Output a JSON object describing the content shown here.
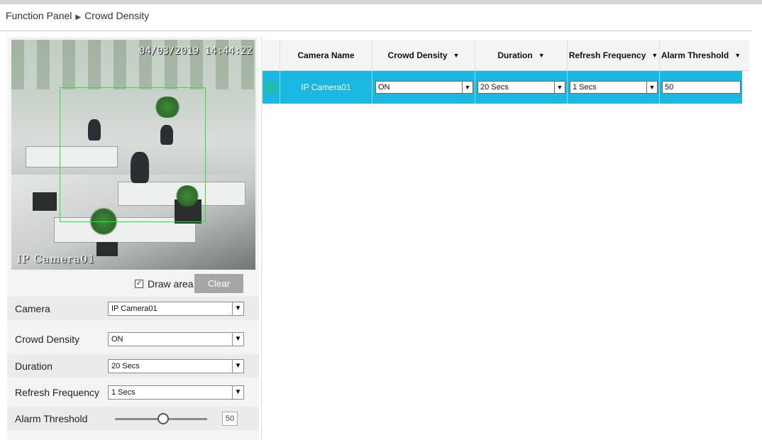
{
  "breadcrumb": {
    "parent": "Function Panel",
    "current": "Crowd Density"
  },
  "video": {
    "timestamp": "04/03/2019 14:44:22",
    "camera_label": "IP Camera01"
  },
  "draw_area": {
    "label": "Draw area",
    "checked": true,
    "clear_label": "Clear"
  },
  "form": {
    "camera": {
      "label": "Camera",
      "value": "IP Camera01"
    },
    "crowd_density": {
      "label": "Crowd Density",
      "value": "ON"
    },
    "duration": {
      "label": "Duration",
      "value": "20 Secs"
    },
    "refresh_frequency": {
      "label": "Refresh Frequency",
      "value": "1 Secs"
    },
    "alarm_threshold": {
      "label": "Alarm Threshold",
      "value": "50"
    }
  },
  "table": {
    "headers": [
      "Camera Name",
      "Crowd Density",
      "Duration",
      "Refresh Frequency",
      "Alarm Threshold"
    ],
    "rows": [
      {
        "camera_name": "IP Camera01",
        "crowd_density": "ON",
        "duration": "20 Secs",
        "refresh_frequency": "1 Secs",
        "alarm_threshold": "50"
      }
    ]
  },
  "colors": {
    "row_selected": "#1ab7e0",
    "draw_area_border": "#29e33a",
    "clear_button": "#a6a6a6",
    "selected_check": "#2ec84a"
  },
  "icons": [
    "triangle-right-icon",
    "checkbox-checked-icon",
    "dropdown-arrow-icon",
    "sort-caret-icon",
    "row-selected-check-icon",
    "slider-thumb-icon"
  ]
}
